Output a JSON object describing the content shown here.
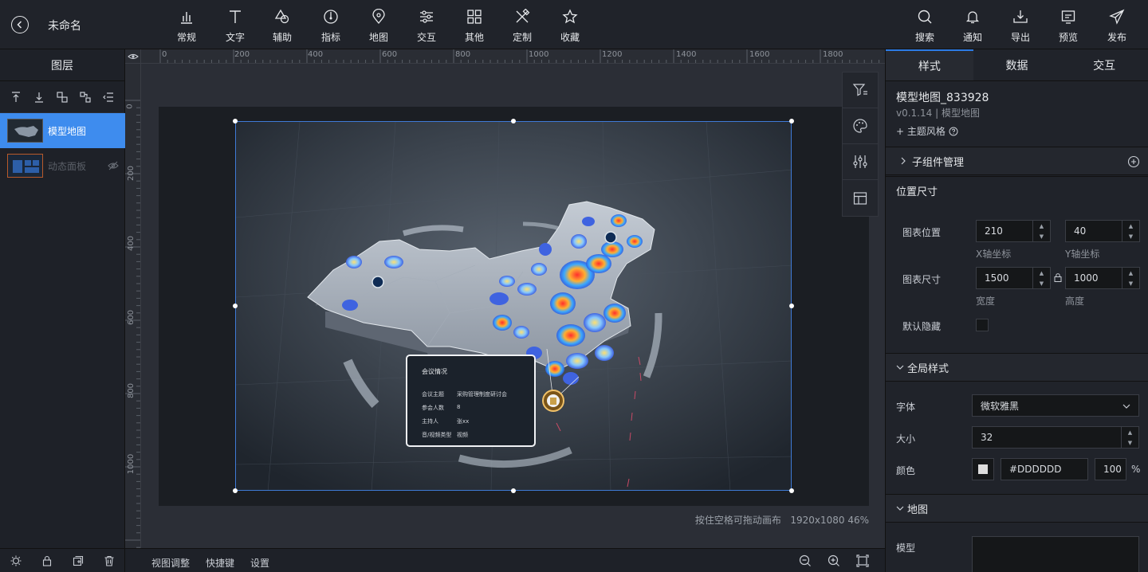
{
  "app": {
    "title": "未命名"
  },
  "toolbar": {
    "items": [
      {
        "label": "常规",
        "icon": "bar-chart-icon"
      },
      {
        "label": "文字",
        "icon": "text-icon"
      },
      {
        "label": "辅助",
        "icon": "shapes-icon"
      },
      {
        "label": "指标",
        "icon": "gauge-icon"
      },
      {
        "label": "地图",
        "icon": "map-pin-icon"
      },
      {
        "label": "交互",
        "icon": "sliders-icon"
      },
      {
        "label": "其他",
        "icon": "grid-icon"
      },
      {
        "label": "定制",
        "icon": "tools-icon"
      },
      {
        "label": "收藏",
        "icon": "star-icon"
      }
    ],
    "right_items": [
      {
        "label": "搜索",
        "icon": "search-icon"
      },
      {
        "label": "通知",
        "icon": "bell-icon"
      },
      {
        "label": "导出",
        "icon": "export-icon"
      },
      {
        "label": "预览",
        "icon": "preview-icon"
      },
      {
        "label": "发布",
        "icon": "send-icon"
      }
    ]
  },
  "layers": {
    "title": "图层",
    "items": [
      {
        "name": "模型地图",
        "selected": true,
        "hidden": false
      },
      {
        "name": "动态面板",
        "selected": false,
        "hidden": true
      }
    ]
  },
  "ruler": {
    "h_ticks": [
      "0",
      "200",
      "400",
      "600",
      "800",
      "1000",
      "1200",
      "1400",
      "1600",
      "1800"
    ],
    "v_ticks": [
      "0",
      "200",
      "400",
      "600",
      "800",
      "1000"
    ]
  },
  "canvas": {
    "popup": {
      "title": "会议情况",
      "rows": [
        {
          "key": "会议主题",
          "value": "采购管理制度研讨会"
        },
        {
          "key": "参会人数",
          "value": "8"
        },
        {
          "key": "主持人",
          "value": "张xx"
        },
        {
          "key": "音/视频类型",
          "value": "视频"
        }
      ]
    },
    "status_hint": "按住空格可拖动画布",
    "status_size": "1920x1080 46%"
  },
  "bottombar": {
    "items": [
      "视图调整",
      "快捷键",
      "设置"
    ]
  },
  "panel": {
    "tabs": [
      "样式",
      "数据",
      "交互"
    ],
    "active_tab": "样式",
    "component_title": "模型地图_833928",
    "component_version": "v0.1.14 | 模型地图",
    "theme_link": "+ 主题风格",
    "sections": {
      "sub_components": "子组件管理",
      "position_size": "位置尺寸",
      "global_style": "全局样式",
      "map": "地图"
    },
    "position": {
      "label": "图表位置",
      "x": "210",
      "y": "40",
      "x_caption": "X轴坐标",
      "y_caption": "Y轴坐标"
    },
    "size": {
      "label": "图表尺寸",
      "width": "1500",
      "height": "1000",
      "w_caption": "宽度",
      "h_caption": "高度"
    },
    "default_hidden": {
      "label": "默认隐藏"
    },
    "font": {
      "label": "字体",
      "value": "微软雅黑"
    },
    "font_size": {
      "label": "大小",
      "value": "32"
    },
    "color": {
      "label": "颜色",
      "hex": "#DDDDDD",
      "opacity": "100",
      "unit": "%"
    },
    "model": {
      "label": "模型"
    }
  },
  "colors": {
    "accent": "#2c7be5",
    "selection": "#3f7ad6"
  }
}
